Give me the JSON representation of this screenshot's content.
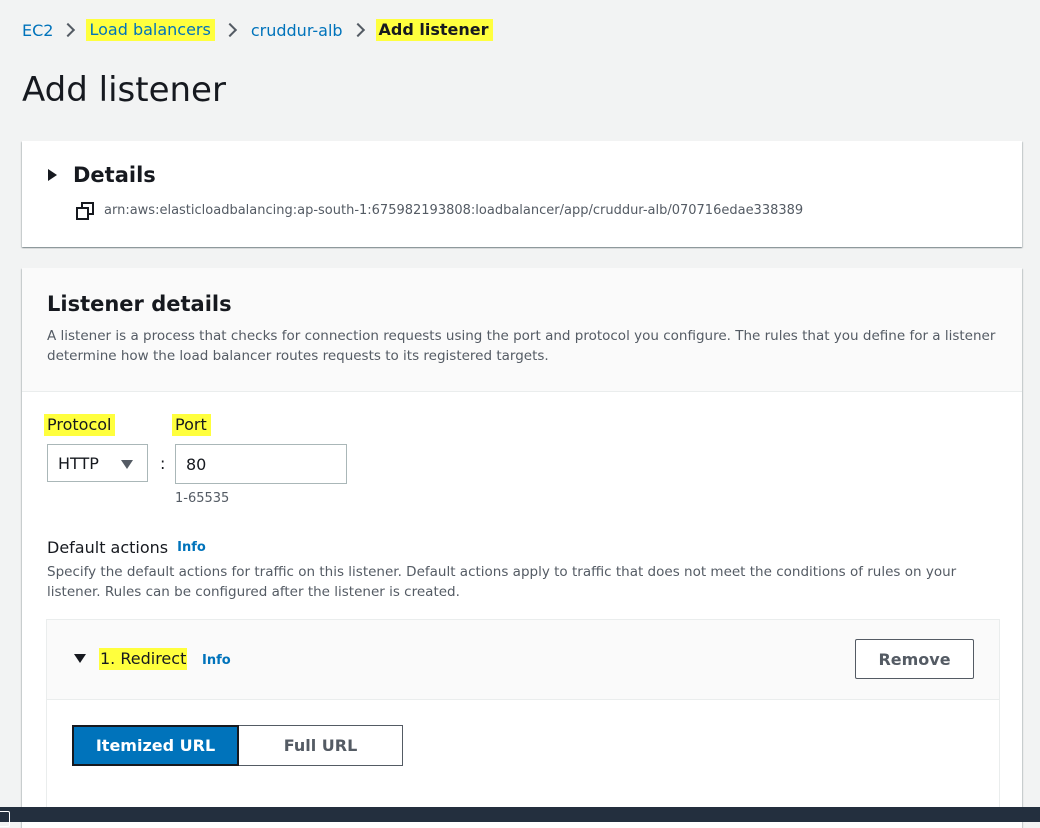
{
  "breadcrumb": {
    "items": [
      "EC2",
      "Load balancers",
      "cruddur-alb"
    ],
    "current": "Add listener"
  },
  "page": {
    "title": "Add listener"
  },
  "details": {
    "title": "Details",
    "arn": "arn:aws:elasticloadbalancing:ap-south-1:675982193808:loadbalancer/app/cruddur-alb/070716edae338389"
  },
  "listener": {
    "title": "Listener details",
    "description": "A listener is a process that checks for connection requests using the port and protocol you configure. The rules that you define for a listener determine how the load balancer routes requests to its registered targets.",
    "protocol_label": "Protocol",
    "protocol_value": "HTTP",
    "separator": ":",
    "port_label": "Port",
    "port_value": "80",
    "port_hint": "1-65535",
    "default_actions_label": "Default actions",
    "info": "Info",
    "default_actions_desc": "Specify the default actions for traffic on this listener. Default actions apply to traffic that does not meet the conditions of rules on your listener. Rules can be configured after the listener is created."
  },
  "action": {
    "title": "1. Redirect",
    "info": "Info",
    "remove_label": "Remove",
    "tabs": [
      "Itemized URL",
      "Full URL"
    ],
    "selected_tab": "Itemized URL"
  },
  "colors": {
    "link": "#0073bb",
    "highlight": "#ffff3d",
    "primary": "#0073bb",
    "page_bg": "#f2f3f3"
  }
}
